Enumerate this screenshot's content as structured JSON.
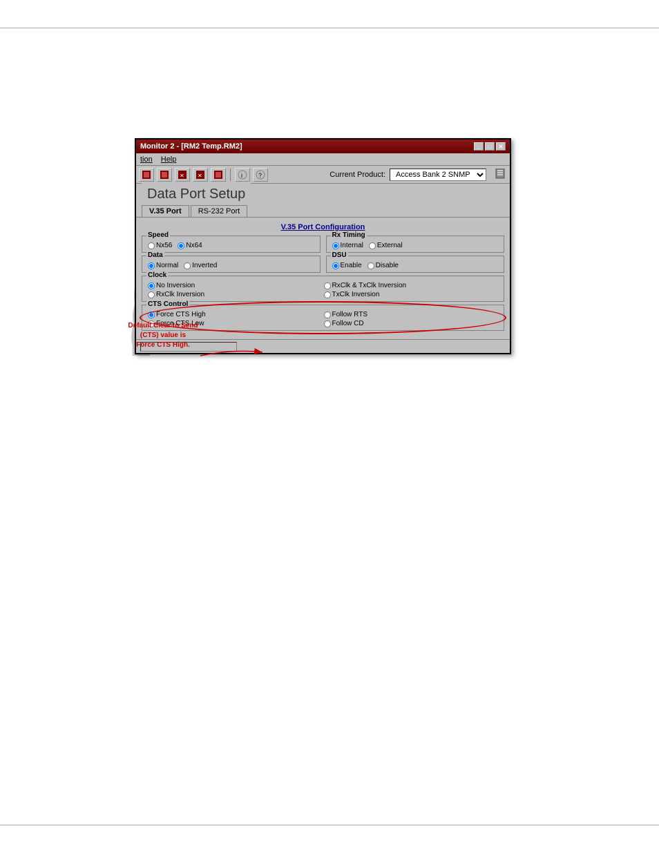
{
  "page": {
    "background": "#ffffff"
  },
  "window": {
    "title": "Monitor 2 - [RM2 Temp.RM2]",
    "title_bar_buttons": [
      "_",
      "□",
      "✕"
    ],
    "menu_items": [
      "tion",
      "Help"
    ],
    "current_product_label": "Current Product:",
    "current_product_value": "Access Bank 2 SNMP",
    "page_title": "Data Port Setup",
    "tabs": [
      "V.35 Port",
      "RS-232 Port"
    ],
    "active_tab": "V.35 Port"
  },
  "v35_config": {
    "section_title": "V.35 Port Configuration",
    "speed": {
      "title": "Speed",
      "options": [
        "Nx56",
        "Nx64"
      ],
      "selected": "Nx64"
    },
    "rx_timing": {
      "title": "Rx Timing",
      "options": [
        "Internal",
        "External"
      ],
      "selected": "Internal"
    },
    "data": {
      "title": "Data",
      "options": [
        "Normal",
        "Inverted"
      ],
      "selected": "Normal"
    },
    "dsu": {
      "title": "DSU",
      "options": [
        "Enable",
        "Disable"
      ],
      "selected": "Enable"
    },
    "clock": {
      "title": "Clock",
      "options": [
        "No Inversion",
        "RxClk & TxClk Inversion",
        "RxClk Inversion",
        "TxClk Inversion"
      ],
      "selected": "No Inversion"
    },
    "cts_control": {
      "title": "CTS Control",
      "options": [
        "Force CTS High",
        "Follow RTS",
        "Force CTS Low",
        "Follow CD"
      ],
      "selected": "Force CTS High"
    }
  },
  "annotation": {
    "text": "Default Clear to Send\n(CTS) value is\nForce CTS High.",
    "color": "#cc0000"
  }
}
